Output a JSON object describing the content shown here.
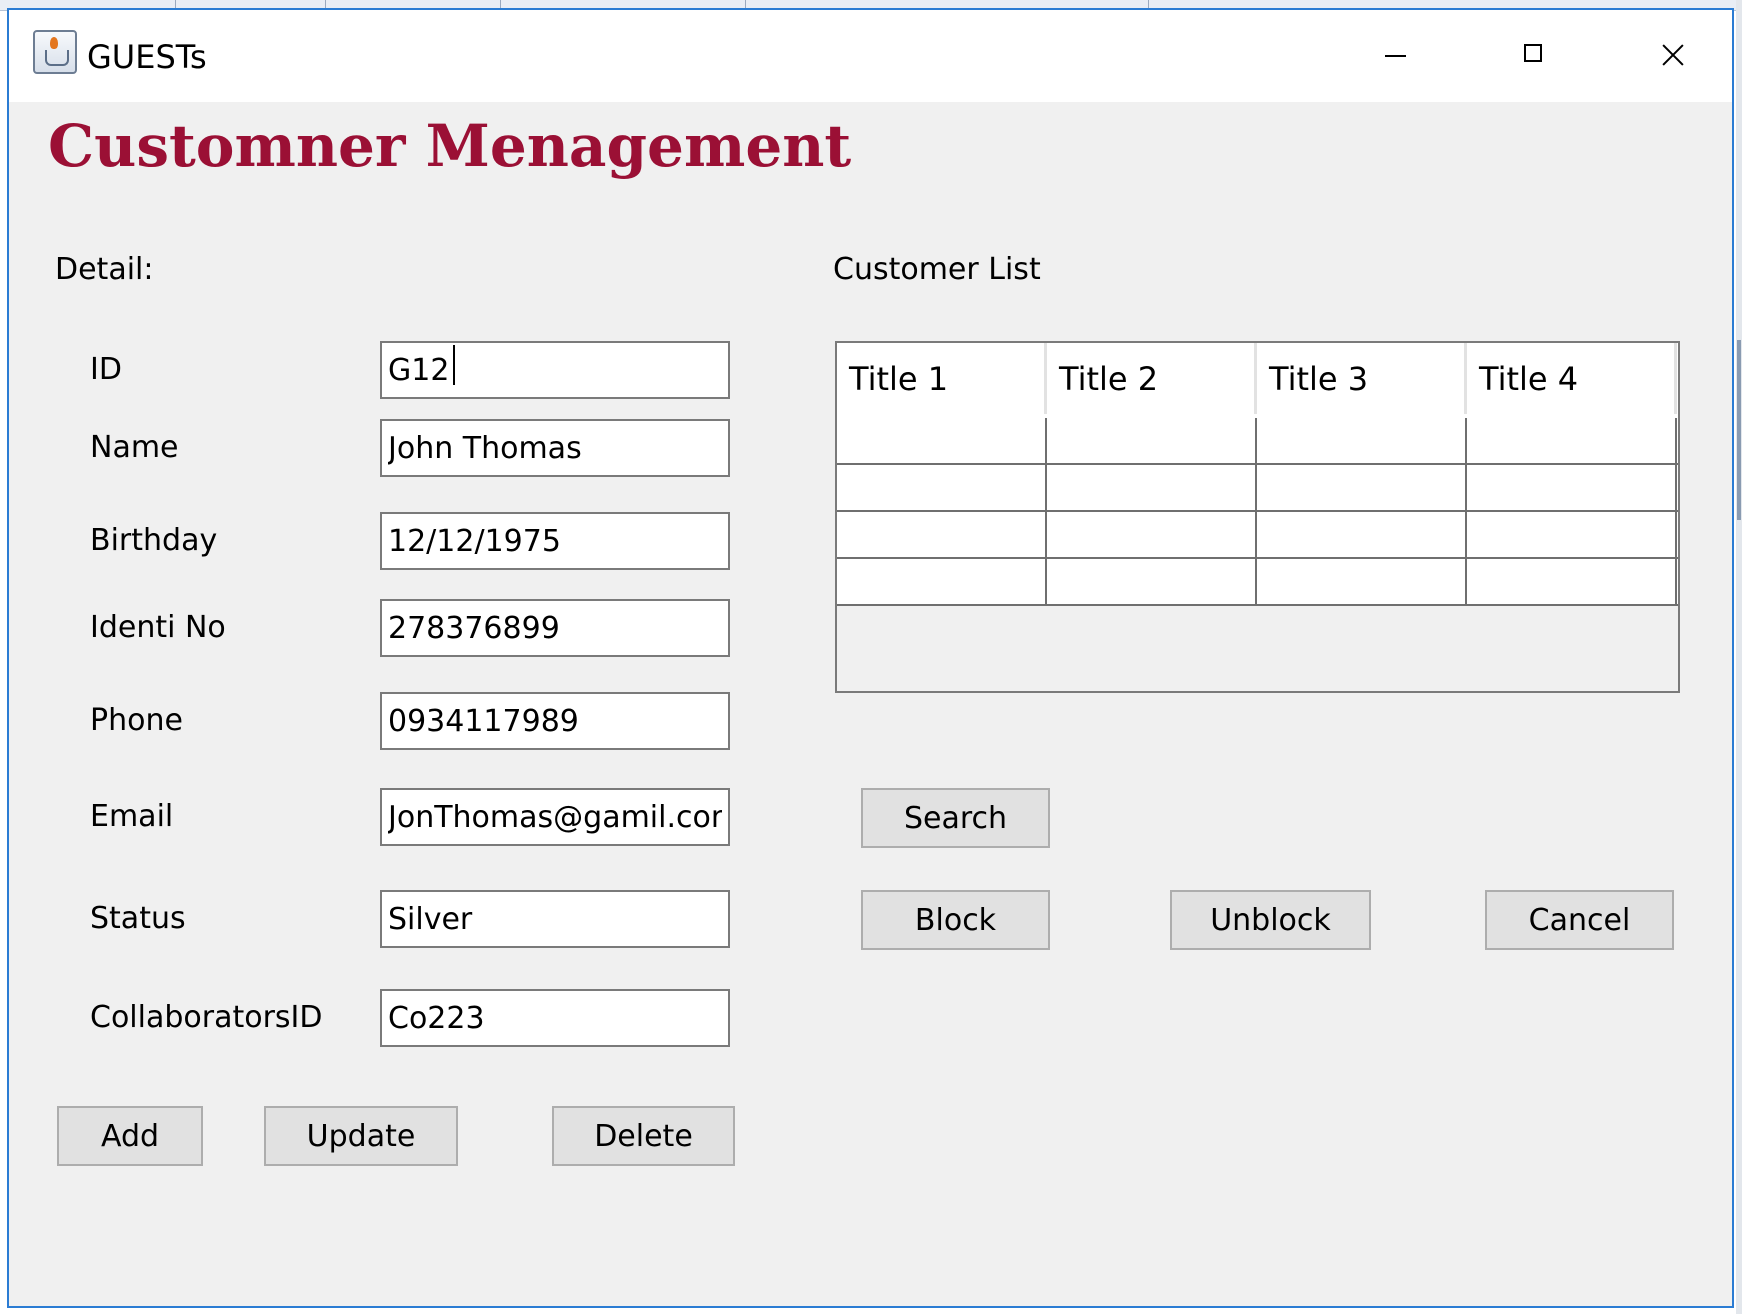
{
  "window": {
    "title": "GUESTs"
  },
  "heading": "Customner Menagement",
  "detail_label": "Detail:",
  "list_label": "Customer List",
  "fields": {
    "id": {
      "label": "ID",
      "value": "G12"
    },
    "name": {
      "label": "Name",
      "value": "John Thomas"
    },
    "birthday": {
      "label": "Birthday",
      "value": "12/12/1975"
    },
    "identi_no": {
      "label": "Identi No",
      "value": "278376899"
    },
    "phone": {
      "label": "Phone",
      "value": "0934117989"
    },
    "email": {
      "label": "Email",
      "value": "JonThomas@gamil.com"
    },
    "status": {
      "label": "Status",
      "value": "Silver"
    },
    "collaborators_id": {
      "label": "CollaboratorsID",
      "value": "Co223"
    }
  },
  "buttons": {
    "add": "Add",
    "update": "Update",
    "delete": "Delete",
    "search": "Search",
    "block": "Block",
    "unblock": "Unblock",
    "cancel": "Cancel"
  },
  "table": {
    "columns": [
      "Title 1",
      "Title 2",
      "Title 3",
      "Title 4"
    ],
    "rows": [
      [
        "",
        "",
        "",
        ""
      ],
      [
        "",
        "",
        "",
        ""
      ],
      [
        "",
        "",
        "",
        ""
      ],
      [
        "",
        "",
        "",
        ""
      ]
    ]
  },
  "colors": {
    "heading": "#9b1035",
    "window_border": "#2b7cd3",
    "panel": "#f0f0f0"
  }
}
